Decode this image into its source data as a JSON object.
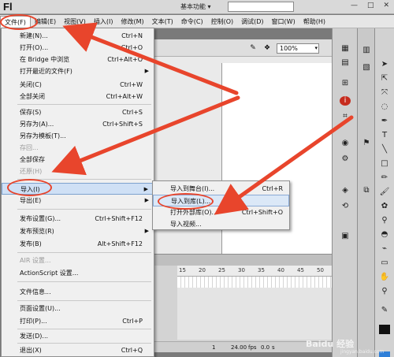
{
  "app": {
    "logo": "Fl",
    "workspace": "基本功能",
    "workspace_arrow": "▾"
  },
  "window_buttons": [
    "—",
    "□",
    "✕"
  ],
  "menubar": [
    {
      "id": "file",
      "label": "文件(F)"
    },
    {
      "id": "edit",
      "label": "编辑(E)"
    },
    {
      "id": "view",
      "label": "视图(V)"
    },
    {
      "id": "insert",
      "label": "插入(I)"
    },
    {
      "id": "modify",
      "label": "修改(M)"
    },
    {
      "id": "text",
      "label": "文本(T)"
    },
    {
      "id": "commands",
      "label": "命令(C)"
    },
    {
      "id": "control",
      "label": "控制(O)"
    },
    {
      "id": "debug",
      "label": "调试(D)"
    },
    {
      "id": "window",
      "label": "窗口(W)"
    },
    {
      "id": "help",
      "label": "帮助(H)"
    }
  ],
  "file_menu": {
    "items": [
      {
        "label": "新建(N)...",
        "shortcut": "Ctrl+N"
      },
      {
        "label": "打开(O)...",
        "shortcut": "Ctrl+O"
      },
      {
        "label": "在 Bridge 中浏览",
        "shortcut": "Ctrl+Alt+O"
      },
      {
        "label": "打开最近的文件(F)",
        "shortcut": "",
        "submenu": "▶"
      },
      {
        "label": "关闭(C)",
        "shortcut": "Ctrl+W"
      },
      {
        "label": "全部关闭",
        "shortcut": "Ctrl+Alt+W"
      },
      {
        "label": "保存(S)",
        "shortcut": "Ctrl+S"
      },
      {
        "label": "另存为(A)...",
        "shortcut": "Ctrl+Shift+S"
      },
      {
        "label": "另存为模板(T)...",
        "shortcut": ""
      },
      {
        "label": "存回...",
        "shortcut": "",
        "disabled": true
      },
      {
        "label": "全部保存",
        "shortcut": ""
      },
      {
        "label": "还原(H)",
        "shortcut": "",
        "disabled": true
      },
      {
        "label": "导入(I)",
        "shortcut": "",
        "submenu": "▶"
      },
      {
        "label": "导出(E)",
        "shortcut": "",
        "submenu": "▶"
      },
      {
        "label": "发布设置(G)...",
        "shortcut": "Ctrl+Shift+F12"
      },
      {
        "label": "发布预览(R)",
        "shortcut": "",
        "submenu": "▶"
      },
      {
        "label": "发布(B)",
        "shortcut": "Alt+Shift+F12"
      },
      {
        "label": "AIR 设置...",
        "shortcut": "",
        "disabled": true
      },
      {
        "label": "ActionScript 设置...",
        "shortcut": ""
      },
      {
        "label": "文件信息...",
        "shortcut": ""
      },
      {
        "label": "页面设置(U)...",
        "shortcut": ""
      },
      {
        "label": "打印(P)...",
        "shortcut": "Ctrl+P"
      },
      {
        "label": "发送(D)...",
        "shortcut": ""
      },
      {
        "label": "退出(X)",
        "shortcut": "Ctrl+Q"
      }
    ]
  },
  "import_submenu": {
    "items": [
      {
        "label": "导入到舞台(I)...",
        "shortcut": "Ctrl+R"
      },
      {
        "label": "导入到库(L)...",
        "shortcut": ""
      },
      {
        "label": "打开外部库(O)...",
        "shortcut": "Ctrl+Shift+O"
      },
      {
        "label": "导入视频...",
        "shortcut": ""
      }
    ]
  },
  "stage": {
    "zoom": "100%",
    "zoom_arrow": "▾"
  },
  "timeline": {
    "ruler": [
      "15",
      "20",
      "25",
      "30",
      "35",
      "40",
      "45",
      "50"
    ],
    "status": {
      "frame": "1",
      "fps": "24.00",
      "fps_unit": "fps",
      "time": "0.0",
      "time_unit": "s"
    }
  },
  "watermark": {
    "text": "Baidu 经验",
    "sub": "jingyan.baidu.com"
  },
  "colors": {
    "annotation": "#e8452c",
    "highlight": "#cfe0f5"
  }
}
